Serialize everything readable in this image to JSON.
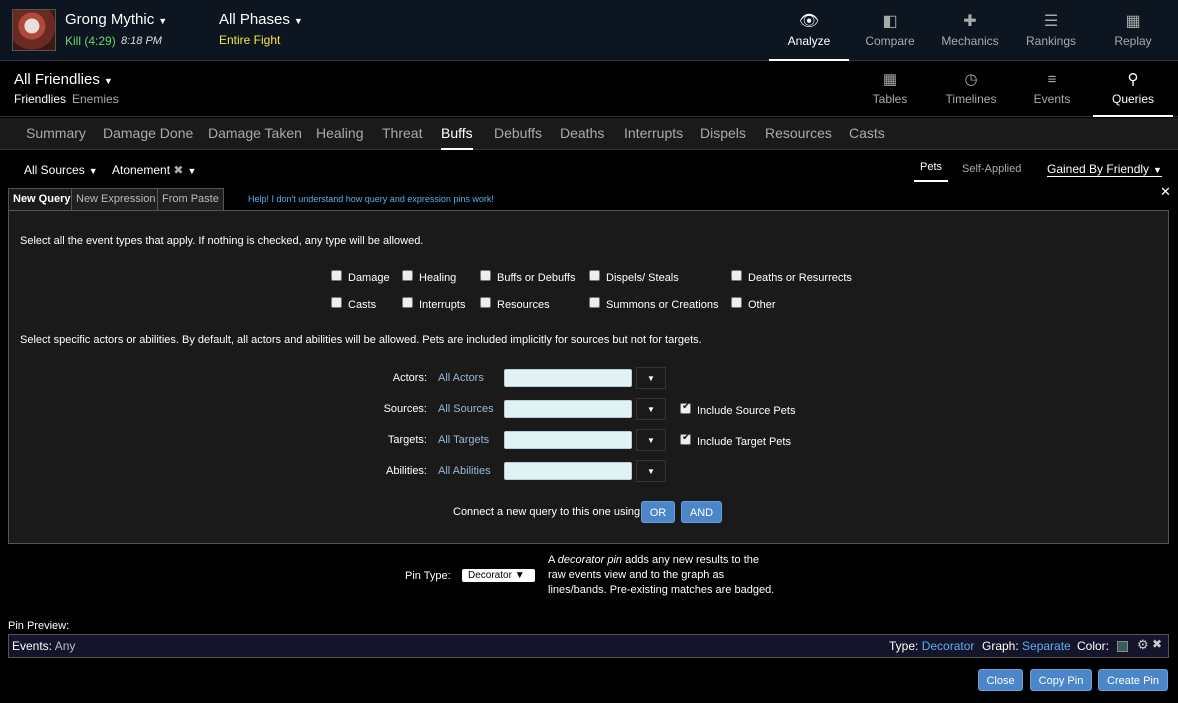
{
  "header": {
    "boss_name": "Grong Mythic",
    "kill_label": "Kill (4:29)",
    "kill_time": "8:18 PM",
    "phase": "All Phases",
    "phase_sub": "Entire Fight",
    "nav": [
      {
        "label": "Analyze",
        "icon": "eye-icon"
      },
      {
        "label": "Compare",
        "icon": "compare-icon"
      },
      {
        "label": "Mechanics",
        "icon": "puzzle-icon"
      },
      {
        "label": "Rankings",
        "icon": "rankings-icon"
      },
      {
        "label": "Replay",
        "icon": "film-icon"
      }
    ]
  },
  "subheader": {
    "title": "All Friendlies",
    "tabs": [
      "Friendlies",
      "Enemies"
    ],
    "nav": [
      {
        "label": "Tables",
        "icon": "grid-icon"
      },
      {
        "label": "Timelines",
        "icon": "clock-icon"
      },
      {
        "label": "Events",
        "icon": "list-icon"
      },
      {
        "label": "Queries",
        "icon": "pin-icon"
      }
    ]
  },
  "tabs": [
    "Summary",
    "Damage Done",
    "Damage Taken",
    "Healing",
    "Threat",
    "Buffs",
    "Debuffs",
    "Deaths",
    "Interrupts",
    "Dispels",
    "Resources",
    "Casts"
  ],
  "active_tab": "Buffs",
  "filters": {
    "sources": "All Sources",
    "ability": "Atonement",
    "pets": "Pets",
    "self_applied": "Self-Applied",
    "gained": "Gained By Friendly"
  },
  "query_tabs": [
    "New Query",
    "New Expression",
    "From Paste"
  ],
  "help_link": "Help! I don't understand how query and expression pins work!",
  "panel": {
    "event_intro": "Select all the event types that apply. If nothing is checked, any type will be allowed.",
    "event_types": [
      {
        "label": "Damage",
        "checked": false
      },
      {
        "label": "Healing",
        "checked": false
      },
      {
        "label": "Buffs or Debuffs",
        "checked": false
      },
      {
        "label": "Dispels/ Steals",
        "checked": false
      },
      {
        "label": "Deaths or Resurrects",
        "checked": false
      },
      {
        "label": "Casts",
        "checked": false
      },
      {
        "label": "Interrupts",
        "checked": false
      },
      {
        "label": "Resources",
        "checked": false
      },
      {
        "label": "Summons or Creations",
        "checked": false
      },
      {
        "label": "Other",
        "checked": false
      }
    ],
    "actors_intro": "Select specific actors or abilities. By default, all actors and abilities will be allowed. Pets are included implicitly for sources but not for targets.",
    "fields": [
      {
        "label": "Actors:",
        "value": "All Actors"
      },
      {
        "label": "Sources:",
        "value": "All Sources",
        "check_label": "Include Source Pets",
        "checked": true
      },
      {
        "label": "Targets:",
        "value": "All Targets",
        "check_label": "Include Target Pets",
        "checked": true
      },
      {
        "label": "Abilities:",
        "value": "All Abilities"
      }
    ],
    "connect_label": "Connect a new query to this one using",
    "or_label": "OR",
    "and_label": "AND"
  },
  "pin_type": {
    "label": "Pin Type:",
    "selected": "Decorator",
    "desc_pre": "A ",
    "desc_em": "decorator pin",
    "desc_post": " adds any new results to the raw events view and to the graph as lines/bands. Pre-existing matches are badged."
  },
  "preview": {
    "title": "Pin Preview:",
    "events_label": "Events:",
    "events_value": "Any",
    "type_label": "Type:",
    "type_value": "Decorator",
    "graph_label": "Graph:",
    "graph_value": "Separate",
    "color_label": "Color:",
    "color": "#3a5e58"
  },
  "buttons": {
    "close": "Close",
    "copy": "Copy Pin",
    "create": "Create Pin"
  },
  "colors": {
    "accent": "#4a86c8",
    "kill": "#6fd36f",
    "phase_sub": "#f2e74a",
    "link": "#5ab0f0"
  }
}
